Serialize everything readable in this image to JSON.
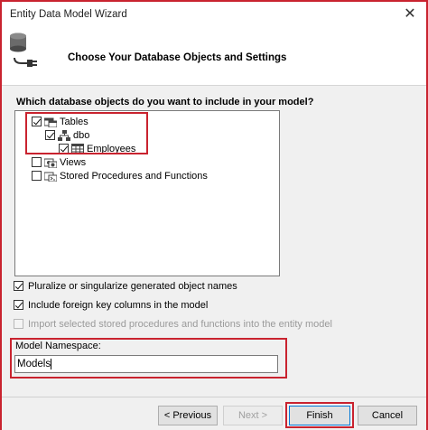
{
  "window": {
    "title": "Entity Data Model Wizard"
  },
  "header": {
    "title": "Choose Your Database Objects and Settings",
    "icon": "database-connect-icon"
  },
  "question": "Which database objects do you want to include in your model?",
  "tree": {
    "items": [
      {
        "label": "Tables",
        "checked": true,
        "icon": "tables-folder-icon"
      },
      {
        "label": "dbo",
        "checked": true,
        "icon": "schema-icon"
      },
      {
        "label": "Employees",
        "checked": true,
        "icon": "table-grid-icon"
      },
      {
        "label": "Views",
        "checked": false,
        "icon": "views-folder-icon"
      },
      {
        "label": "Stored Procedures and Functions",
        "checked": false,
        "icon": "procedures-folder-icon"
      }
    ]
  },
  "options": {
    "pluralize": {
      "label": "Pluralize or singularize generated object names",
      "checked": true
    },
    "foreign_keys": {
      "label": "Include foreign key columns in the model",
      "checked": true
    },
    "import_procs": {
      "label": "Import selected stored procedures and functions into the entity model",
      "checked": false,
      "disabled": true
    }
  },
  "namespace": {
    "label": "Model Namespace:",
    "value": "Models"
  },
  "buttons": {
    "previous": "< Previous",
    "next": "Next >",
    "finish": "Finish",
    "cancel": "Cancel"
  },
  "colors": {
    "highlight": "#c9232f",
    "accent": "#0078d7"
  }
}
